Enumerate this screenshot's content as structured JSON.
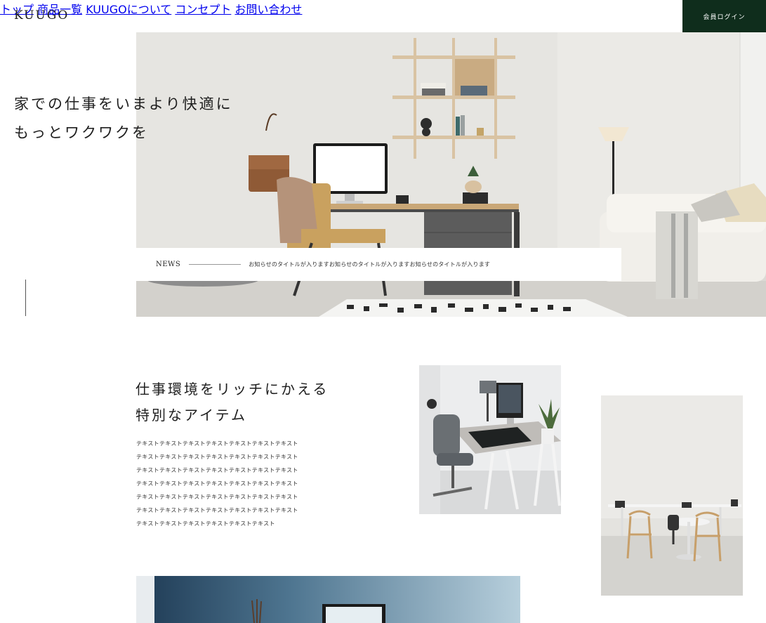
{
  "header": {
    "logo": "KUUGO",
    "nav": [
      "トップ",
      "商品一覧",
      "KUUGOについて",
      "コンセプト",
      "お問い合わせ"
    ],
    "login": "会員ログイン"
  },
  "hero": {
    "line1": "家での仕事をいまより快適に",
    "line2": "もっとワクワクを"
  },
  "news": {
    "label": "NEWS",
    "text": "お知らせのタイトルが入りますお知らせのタイトルが入りますお知らせのタイトルが入ります"
  },
  "feature": {
    "title1": "仕事環境をリッチにかえる",
    "title2": "特別なアイテム",
    "body": [
      "テキストテキストテキストテキストテキストテキストテキスト",
      "テキストテキストテキストテキストテキストテキストテキスト",
      "テキストテキストテキストテキストテキストテキストテキスト",
      "テキストテキストテキストテキストテキストテキストテキスト",
      "テキストテキストテキストテキストテキストテキストテキスト",
      "テキストテキストテキストテキストテキストテキストテキスト",
      "テキストテキストテキストテキストテキストテキスト"
    ]
  },
  "colors": {
    "login_bg": "#0f2d1c",
    "text": "#1f1f1f"
  }
}
